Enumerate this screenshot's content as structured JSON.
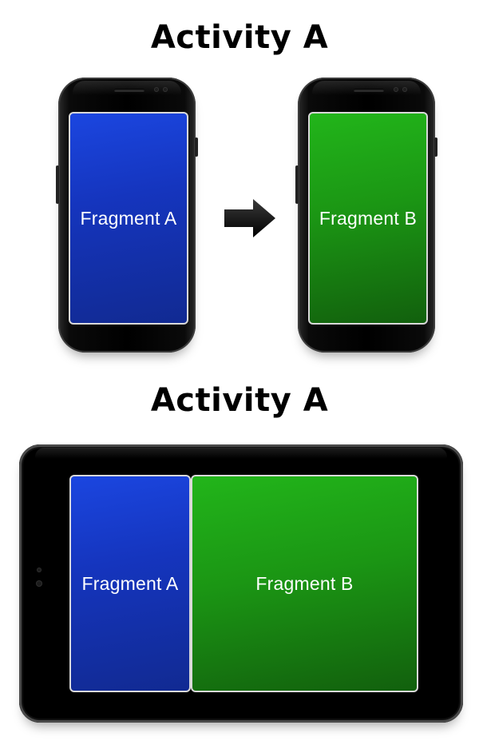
{
  "titles": {
    "top": "Activity A",
    "bottom": "Activity A"
  },
  "phone_left": {
    "fragment_label": "Fragment A",
    "color": "#1535be"
  },
  "phone_right": {
    "fragment_label": "Fragment B",
    "color": "#1b9614"
  },
  "tablet": {
    "fragment_a_label": "Fragment A",
    "fragment_b_label": "Fragment B"
  },
  "colors": {
    "fragment_a": "#1535be",
    "fragment_b": "#1b9614",
    "device_body": "#000000",
    "screen_border": "#d9d9d9"
  },
  "icons": {
    "transition": "right-arrow-icon"
  }
}
